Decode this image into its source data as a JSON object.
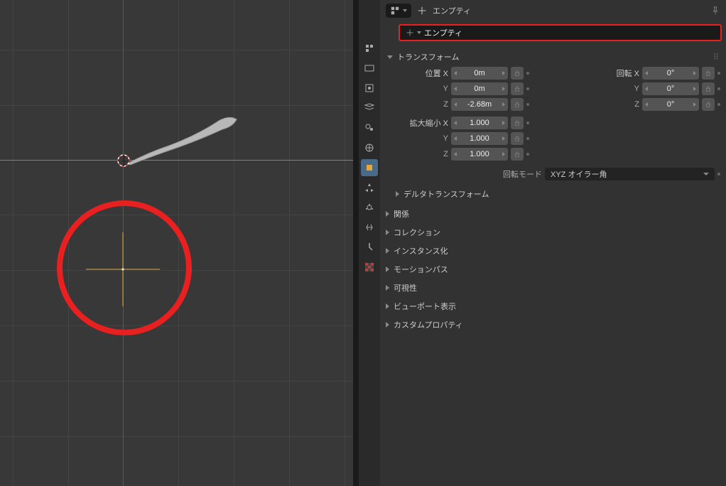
{
  "header": {
    "breadcrumb": "エンプティ",
    "object_name": "エンプティ"
  },
  "transform": {
    "title": "トランスフォーム",
    "location": {
      "label": "位置",
      "x": "0m",
      "y": "0m",
      "z": "-2.68m"
    },
    "rotation": {
      "label": "回転",
      "x": "0°",
      "y": "0°",
      "z": "0°"
    },
    "scale": {
      "label": "拡大縮小",
      "x": "1.000",
      "y": "1.000",
      "z": "1.000"
    },
    "rotation_mode": {
      "label": "回転モード",
      "value": "XYZ オイラー角"
    }
  },
  "sections": [
    "デルタトランスフォーム",
    "関係",
    "コレクション",
    "インスタンス化",
    "モーションパス",
    "可視性",
    "ビューポート表示",
    "カスタムプロパティ"
  ],
  "axis_labels": {
    "x": "X",
    "y": "Y",
    "z": "Z"
  }
}
